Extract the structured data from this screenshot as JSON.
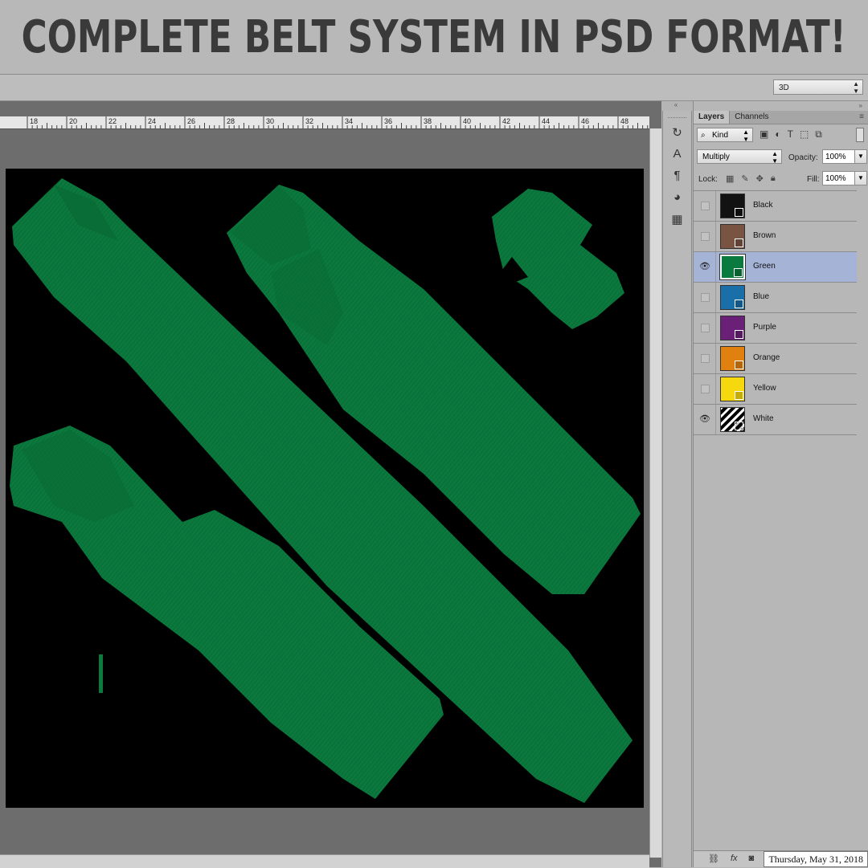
{
  "banner": {
    "title": "COMPLETE BELT SYSTEM IN PSD FORMAT!"
  },
  "options_bar": {
    "workspace": "3D"
  },
  "ruler": {
    "labels": [
      "18",
      "20",
      "22",
      "24",
      "26",
      "28",
      "30",
      "32",
      "34",
      "36",
      "38",
      "40",
      "42",
      "44",
      "46",
      "48"
    ]
  },
  "canvas": {
    "background": "#000000",
    "belt_color": "#0b7a3e"
  },
  "toolstrip": {
    "icons": [
      "3d-rotate-icon",
      "character-icon",
      "paragraph-icon",
      "swatches-icon",
      "grid-icon"
    ]
  },
  "panel": {
    "tabs": [
      {
        "label": "Layers"
      },
      {
        "label": "Channels"
      }
    ],
    "filter": {
      "label": "Kind"
    },
    "blend_mode": "Multiply",
    "opacity_label": "Opacity:",
    "opacity_value": "100%",
    "lock_label": "Lock:",
    "fill_label": "Fill:",
    "fill_value": "100%",
    "layers": [
      {
        "name": "Black",
        "color": "#121212",
        "visible": false,
        "selected": false
      },
      {
        "name": "Brown",
        "color": "#7a5443",
        "visible": false,
        "selected": false
      },
      {
        "name": "Green",
        "color": "#0b7a3e",
        "visible": true,
        "selected": true
      },
      {
        "name": "Blue",
        "color": "#1b6fa8",
        "visible": false,
        "selected": false
      },
      {
        "name": "Purple",
        "color": "#6a2077",
        "visible": false,
        "selected": false
      },
      {
        "name": "Orange",
        "color": "#e0800e",
        "visible": false,
        "selected": false
      },
      {
        "name": "Yellow",
        "color": "#f5d80e",
        "visible": false,
        "selected": false
      },
      {
        "name": "White",
        "color": "#000000",
        "visible": true,
        "selected": false
      }
    ]
  },
  "tooltip": {
    "date": "Thursday, May 31, 2018"
  }
}
